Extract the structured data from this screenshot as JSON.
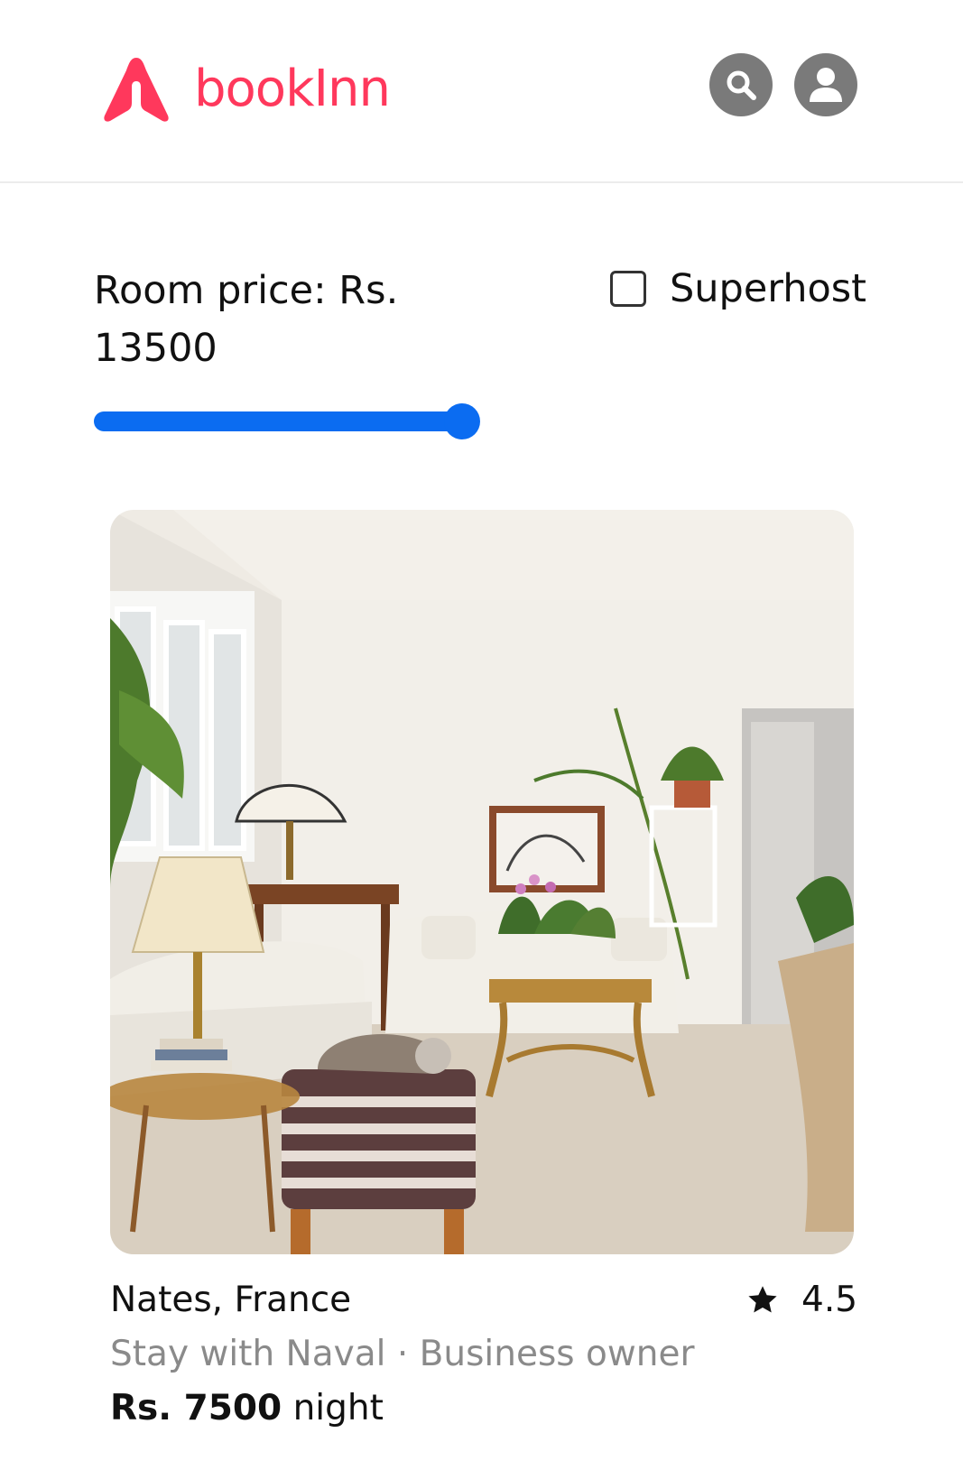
{
  "header": {
    "brand": "bookInn",
    "brand_color": "#ff385c",
    "logo_icon": "brand-a-logo-icon",
    "search_icon": "search-icon",
    "profile_icon": "user-avatar-icon"
  },
  "filters": {
    "price_label": "Room price: Rs. 13500",
    "price_value": 13500,
    "slider_fill_fraction": 1.0,
    "slider_color": "#0b6cf1",
    "superhost_label": "Superhost",
    "superhost_checked": false
  },
  "listing": {
    "image_description_icon": "room-photo",
    "location": "Nates, France",
    "rating": "4.5",
    "rating_icon": "star-icon",
    "host_line": "Stay with Naval · Business owner",
    "price_amount": "Rs. 7500",
    "price_unit": "night"
  }
}
